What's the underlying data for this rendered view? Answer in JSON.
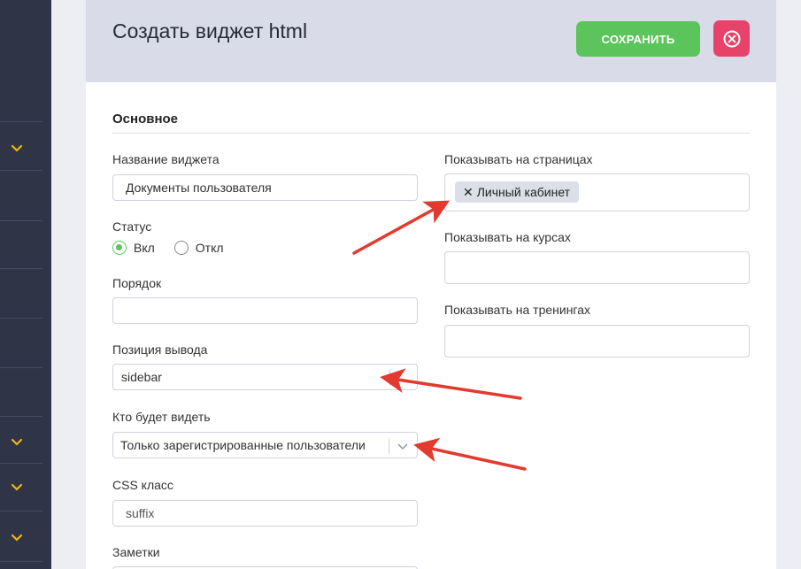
{
  "header": {
    "title": "Создать виджет html",
    "save_label": "СОХРАНИТЬ"
  },
  "section": {
    "title": "Основное"
  },
  "fields": {
    "widget_name": {
      "label": "Название виджета",
      "value": "Документы пользователя"
    },
    "status": {
      "label": "Статус",
      "options": [
        {
          "label": "Вкл",
          "selected": true
        },
        {
          "label": "Откл",
          "selected": false
        }
      ]
    },
    "order": {
      "label": "Порядок",
      "value": ""
    },
    "position": {
      "label": "Позиция вывода",
      "value": "sidebar"
    },
    "visibility": {
      "label": "Кто будет видеть",
      "value": "Только зарегистрированные пользователи"
    },
    "css_class": {
      "label": "CSS класс",
      "value": "suffix"
    },
    "notes": {
      "label": "Заметки"
    },
    "show_pages": {
      "label": "Показывать на страницах",
      "tags": [
        "Личный кабинет"
      ]
    },
    "show_courses": {
      "label": "Показывать на курсах",
      "value": ""
    },
    "show_trainings": {
      "label": "Показывать на тренингах",
      "value": ""
    }
  },
  "colors": {
    "accent_green": "#5bc45a",
    "danger_red": "#e7436a",
    "sidebar_bg": "#2f3447",
    "annotation_arrow": "#e23a2e",
    "chevron_yellow": "#f0b70f"
  },
  "icons": {
    "close": "close-circle-icon",
    "chevron": "chevron-down-icon",
    "tag_remove": "x-icon"
  }
}
